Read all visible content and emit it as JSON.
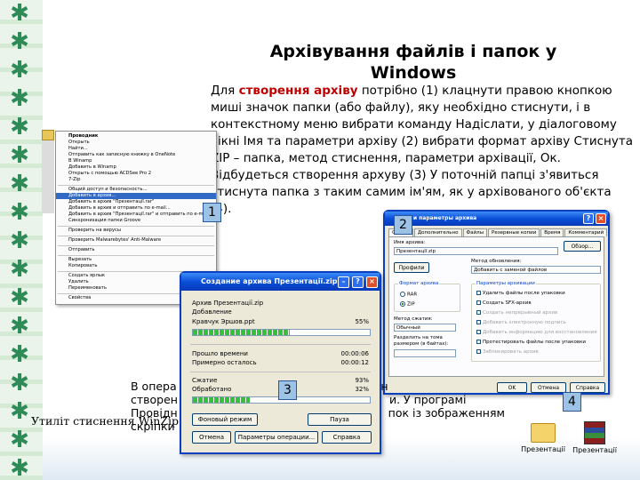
{
  "slide": {
    "title": "Архівування файлів і папок у Windows",
    "paragraph_pre": "Для ",
    "paragraph_highlight": "створення архіву",
    "paragraph_post": " потрібно (1) клацнути правою кнопкою миші значок папки (або файлу), яку необхідно стиснути, і в контекстному меню вибрати команду Надіслати, у діалоговому вікні Імя та параметри архіву (2) вибрати формат архіву Стиснута ZIP – папка, метод стиснення, параметри архівації, Ок. Відбудеться створення архуву (3)  У поточній папці з'явиться стиснута папка з таким самим ім'ям, як у архівованого об'єкта (4).",
    "bottom_line1": "В опера",
    "bottom_line1_tail": "ан",
    "bottom_line2": "створен",
    "bottom_line2_tail": "и.  У програмі",
    "bottom_line3": "Провідн",
    "bottom_line3_tail": "пок із зображенням",
    "bottom_line4": "скріпки",
    "util_caption": "Утиліт стиснення WinZip",
    "badges": [
      "1",
      "2",
      "3",
      "4"
    ],
    "accent_color": "#c00000"
  },
  "context_menu": {
    "items": [
      {
        "label": "Проводник",
        "bold": true
      },
      {
        "label": "Открыть"
      },
      {
        "label": "Найти..."
      },
      {
        "label": "Отправить как записную книжку в OneNote"
      },
      {
        "label": "В Winamp"
      },
      {
        "label": "Добавить в Winamp"
      },
      {
        "label": "Открыть с помощью ACDSee Pro 2"
      },
      {
        "label": "7-Zip"
      },
      {
        "sep": true
      },
      {
        "label": "Общий доступ и безопасность..."
      },
      {
        "label": "Добавить в архив...",
        "selected": true
      },
      {
        "label": "Добавить в архив \"Презентації.rar\""
      },
      {
        "label": "Добавить в архив и отправить по e-mail..."
      },
      {
        "label": "Добавить в архив \"Презентації.rar\" и отправить по e-mail"
      },
      {
        "label": "Синхронизация папки Groove"
      },
      {
        "sep": true
      },
      {
        "label": "Проверить на вирусы"
      },
      {
        "sep": true
      },
      {
        "label": "Проверить Malwarebytes' Anti-Malware"
      },
      {
        "sep": true
      },
      {
        "label": "Отправить"
      },
      {
        "sep": true
      },
      {
        "label": "Вырезать"
      },
      {
        "label": "Копировать"
      },
      {
        "sep": true
      },
      {
        "label": "Создать ярлык"
      },
      {
        "label": "Удалить"
      },
      {
        "label": "Переименовать"
      },
      {
        "sep": true
      },
      {
        "label": "Свойства"
      }
    ]
  },
  "archive_dialog": {
    "title": "Имя и параметры архива",
    "tabs": [
      "Общие",
      "Дополнительно",
      "Файлы",
      "Резервные копии",
      "Время",
      "Комментарий"
    ],
    "archive_name_label": "Имя архива:",
    "archive_name_value": "Презентації.zip",
    "browse_button": "Обзор...",
    "update_method_label": "Метод обновления:",
    "update_method_value": "Добавить с заменой файлов",
    "profiles_button": "Профили",
    "format_group": "Формат архива",
    "format_rar": "RAR",
    "format_zip": "ZIP",
    "compression_label": "Метод сжатия:",
    "compression_value": "Обычный",
    "split_label": "Разделить на тома размером (в байтах):",
    "params_group": "Параметры архивации",
    "options": [
      {
        "label": "Удалить файлы после упаковки",
        "disabled": false
      },
      {
        "label": "Создать SFX-архив",
        "disabled": false
      },
      {
        "label": "Создать непрерывный архив",
        "disabled": true
      },
      {
        "label": "Добавить электронную подпись",
        "disabled": true
      },
      {
        "label": "Добавить информацию для восстановления",
        "disabled": true
      },
      {
        "label": "Протестировать файлы после упаковки",
        "disabled": false
      },
      {
        "label": "Заблокировать архив",
        "disabled": true
      }
    ],
    "ok_button": "OK",
    "cancel_button": "Отмена",
    "help_button": "Справка"
  },
  "progress_dialog": {
    "title": "Создание архива Презентації.zip",
    "line_archive": "Архив Презентації.zip",
    "line_action": "Добавление",
    "line_file": "Кравчук Эршов.ppt",
    "file_percent": "55%",
    "file_progress": 0.55,
    "elapsed_label": "Прошло времени",
    "elapsed_value": "00:00:06",
    "remaining_label": "Примерно осталось",
    "remaining_value": "00:00:12",
    "ratio_label": "Сжатие",
    "ratio_value": "93%",
    "processed_label": "Обработано",
    "processed_value": "32%",
    "processed_progress": 0.32,
    "background_button": "Фоновый режим",
    "pause_button": "Пауза",
    "cancel_button": "Отмена",
    "params_button": "Параметры операции...",
    "help_button": "Справка"
  },
  "result_icons": [
    {
      "label": "Презентації",
      "type": "folder"
    },
    {
      "label": "Презентації",
      "type": "rar"
    }
  ]
}
